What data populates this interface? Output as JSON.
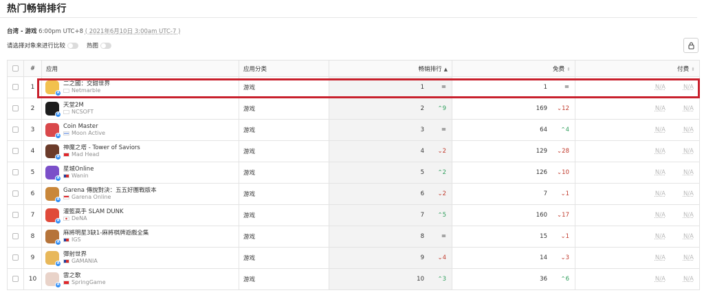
{
  "header": {
    "title": "热门畅销排行"
  },
  "meta": {
    "region": "台湾 - 游戏",
    "time": "6:00pm UTC+8",
    "alt_time": "( 2021年6月10日 3:00am UTC-7 )"
  },
  "controls": {
    "compare_label": "请选择对象来进行比较",
    "heatmap_label": "热图"
  },
  "table": {
    "headers": {
      "index": "#",
      "app": "应用",
      "category": "应用分类",
      "grossing": "畅销排行",
      "free": "免费",
      "paid": "付费"
    },
    "rows": [
      {
        "idx": "1",
        "name": "二之國：交錯世界",
        "publisher": "Netmarble",
        "category": "游戏",
        "grossing": "1",
        "g_change": "=",
        "g_dir": "same",
        "free": "1",
        "f_change": "=",
        "f_dir": "same",
        "paid_a": "N/A",
        "paid_b": "N/A",
        "icon_color": "#f2c14e",
        "flag": "kr"
      },
      {
        "idx": "2",
        "name": "天堂2M",
        "publisher": "NCSOFT",
        "category": "游戏",
        "grossing": "2",
        "g_change": "^9",
        "g_dir": "up",
        "free": "169",
        "f_change": "v12",
        "f_dir": "down",
        "paid_a": "N/A",
        "paid_b": "N/A",
        "icon_color": "#1d1d1d",
        "flag": "kr"
      },
      {
        "idx": "3",
        "name": "Coin Master",
        "publisher": "Moon Active",
        "category": "游戏",
        "grossing": "3",
        "g_change": "=",
        "g_dir": "same",
        "free": "64",
        "f_change": "^4",
        "f_dir": "up",
        "paid_a": "N/A",
        "paid_b": "N/A",
        "icon_color": "#d9484b",
        "flag": "il"
      },
      {
        "idx": "4",
        "name": "神魔之塔 - Tower of Saviors",
        "publisher": "Mad Head",
        "category": "游戏",
        "grossing": "4",
        "g_change": "v2",
        "g_dir": "down",
        "free": "129",
        "f_change": "v28",
        "f_dir": "down",
        "paid_a": "N/A",
        "paid_b": "N/A",
        "icon_color": "#6b3b2a",
        "flag": "hk"
      },
      {
        "idx": "5",
        "name": "星城Online",
        "publisher": "Wanin",
        "category": "游戏",
        "grossing": "5",
        "g_change": "^2",
        "g_dir": "up",
        "free": "126",
        "f_change": "v10",
        "f_dir": "down",
        "paid_a": "N/A",
        "paid_b": "N/A",
        "icon_color": "#7b4fc9",
        "flag": "tw"
      },
      {
        "idx": "6",
        "name": "Garena 傳說對決：五五好團戰版本",
        "publisher": "Garena Online",
        "category": "游戏",
        "grossing": "6",
        "g_change": "v2",
        "g_dir": "down",
        "free": "7",
        "f_change": "v1",
        "f_dir": "down",
        "paid_a": "N/A",
        "paid_b": "N/A",
        "icon_color": "#c9873a",
        "flag": "sg"
      },
      {
        "idx": "7",
        "name": "灌籃高手 SLAM DUNK",
        "publisher": "DeNA",
        "category": "游戏",
        "grossing": "7",
        "g_change": "^5",
        "g_dir": "up",
        "free": "160",
        "f_change": "v17",
        "f_dir": "down",
        "paid_a": "N/A",
        "paid_b": "N/A",
        "icon_color": "#e04a3a",
        "flag": "jp"
      },
      {
        "idx": "8",
        "name": "麻將明星3缺1-麻將棋牌遊戲全集",
        "publisher": "IGS",
        "category": "游戏",
        "grossing": "8",
        "g_change": "=",
        "g_dir": "same",
        "free": "15",
        "f_change": "v1",
        "f_dir": "down",
        "paid_a": "N/A",
        "paid_b": "N/A",
        "icon_color": "#b6743a",
        "flag": "tw"
      },
      {
        "idx": "9",
        "name": "彈射世界",
        "publisher": "GAMANIA",
        "category": "游戏",
        "grossing": "9",
        "g_change": "v4",
        "g_dir": "down",
        "free": "14",
        "f_change": "v3",
        "f_dir": "down",
        "paid_a": "N/A",
        "paid_b": "N/A",
        "icon_color": "#e8b85a",
        "flag": "tw"
      },
      {
        "idx": "10",
        "name": "雲之歌",
        "publisher": "SpringGame",
        "category": "游戏",
        "grossing": "10",
        "g_change": "^3",
        "g_dir": "up",
        "free": "36",
        "f_change": "^6",
        "f_dir": "up",
        "paid_a": "N/A",
        "paid_b": "N/A",
        "icon_color": "#e9d3c9",
        "flag": "cn"
      }
    ]
  }
}
